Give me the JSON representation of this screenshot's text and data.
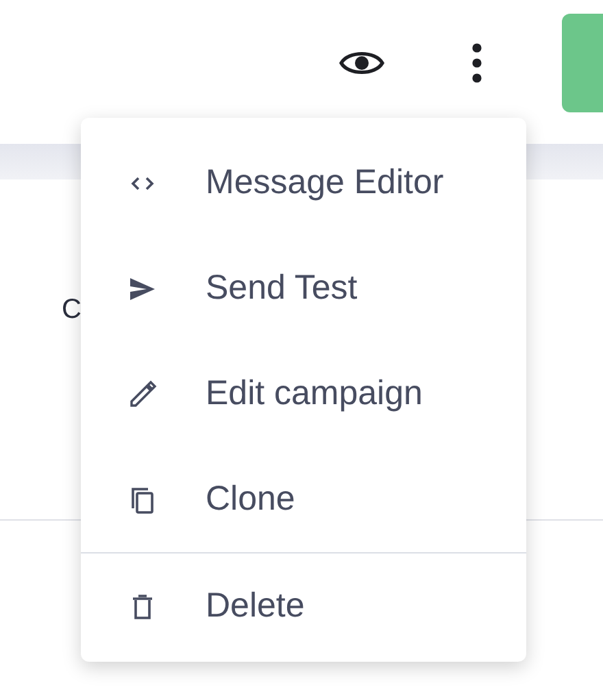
{
  "background": {
    "text": "C"
  },
  "menu": {
    "items": [
      {
        "label": "Message Editor",
        "kind": "code",
        "separated": false
      },
      {
        "label": "Send Test",
        "kind": "send",
        "separated": false
      },
      {
        "label": "Edit campaign",
        "kind": "edit",
        "separated": false
      },
      {
        "label": "Clone",
        "kind": "clone",
        "separated": false
      },
      {
        "label": "Delete",
        "kind": "delete",
        "separated": true
      }
    ]
  }
}
